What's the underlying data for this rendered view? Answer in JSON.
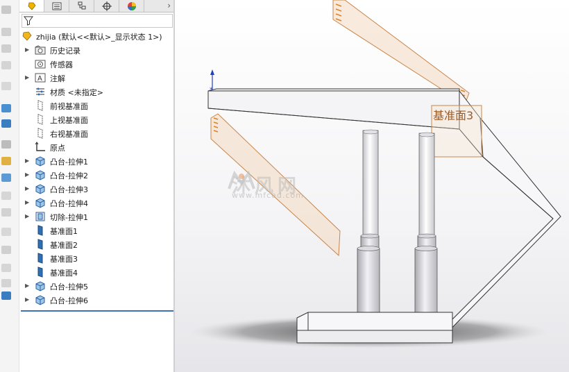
{
  "feature_tree": {
    "root": {
      "label": "zhijia  (默认<<默认>_显示状态 1>)",
      "icon": "part-icon"
    },
    "items": [
      {
        "label": "历史记录",
        "icon": "history-folder-icon",
        "expandable": true
      },
      {
        "label": "传感器",
        "icon": "sensor-icon",
        "expandable": false
      },
      {
        "label": "注解",
        "icon": "annotation-icon",
        "expandable": true
      },
      {
        "label": "材质 <未指定>",
        "icon": "material-icon",
        "expandable": false
      },
      {
        "label": "前视基准面",
        "icon": "plane-icon",
        "expandable": false
      },
      {
        "label": "上视基准面",
        "icon": "plane-icon",
        "expandable": false
      },
      {
        "label": "右视基准面",
        "icon": "plane-icon",
        "expandable": false
      },
      {
        "label": "原点",
        "icon": "origin-icon",
        "expandable": false
      },
      {
        "label": "凸台-拉伸1",
        "icon": "extrude-boss-icon",
        "expandable": true
      },
      {
        "label": "凸台-拉伸2",
        "icon": "extrude-boss-icon",
        "expandable": true
      },
      {
        "label": "凸台-拉伸3",
        "icon": "extrude-boss-icon",
        "expandable": true
      },
      {
        "label": "凸台-拉伸4",
        "icon": "extrude-boss-icon",
        "expandable": true
      },
      {
        "label": "切除-拉伸1",
        "icon": "extrude-cut-icon",
        "expandable": true
      },
      {
        "label": "基准面1",
        "icon": "reference-plane-icon",
        "expandable": false
      },
      {
        "label": "基准面2",
        "icon": "reference-plane-icon",
        "expandable": false
      },
      {
        "label": "基准面3",
        "icon": "reference-plane-icon",
        "expandable": false
      },
      {
        "label": "基准面4",
        "icon": "reference-plane-icon",
        "expandable": false
      },
      {
        "label": "凸台-拉伸5",
        "icon": "extrude-boss-icon",
        "expandable": true
      },
      {
        "label": "凸台-拉伸6",
        "icon": "extrude-boss-icon",
        "expandable": true
      }
    ]
  },
  "viewport": {
    "plane_label": "基准面3",
    "watermark": {
      "text": "沐风网",
      "url": "www.mfcad.com"
    }
  },
  "tabs": [
    {
      "icon": "feature-manager-icon"
    },
    {
      "icon": "property-manager-icon"
    },
    {
      "icon": "configuration-manager-icon"
    },
    {
      "icon": "dimxpert-icon"
    },
    {
      "icon": "display-manager-icon"
    }
  ],
  "colors": {
    "selection_bar": "#3d6fb6",
    "plane_edge": "#c9864a",
    "plane_fill": "#f3d9bf",
    "plane_label": "#9a5a28"
  }
}
